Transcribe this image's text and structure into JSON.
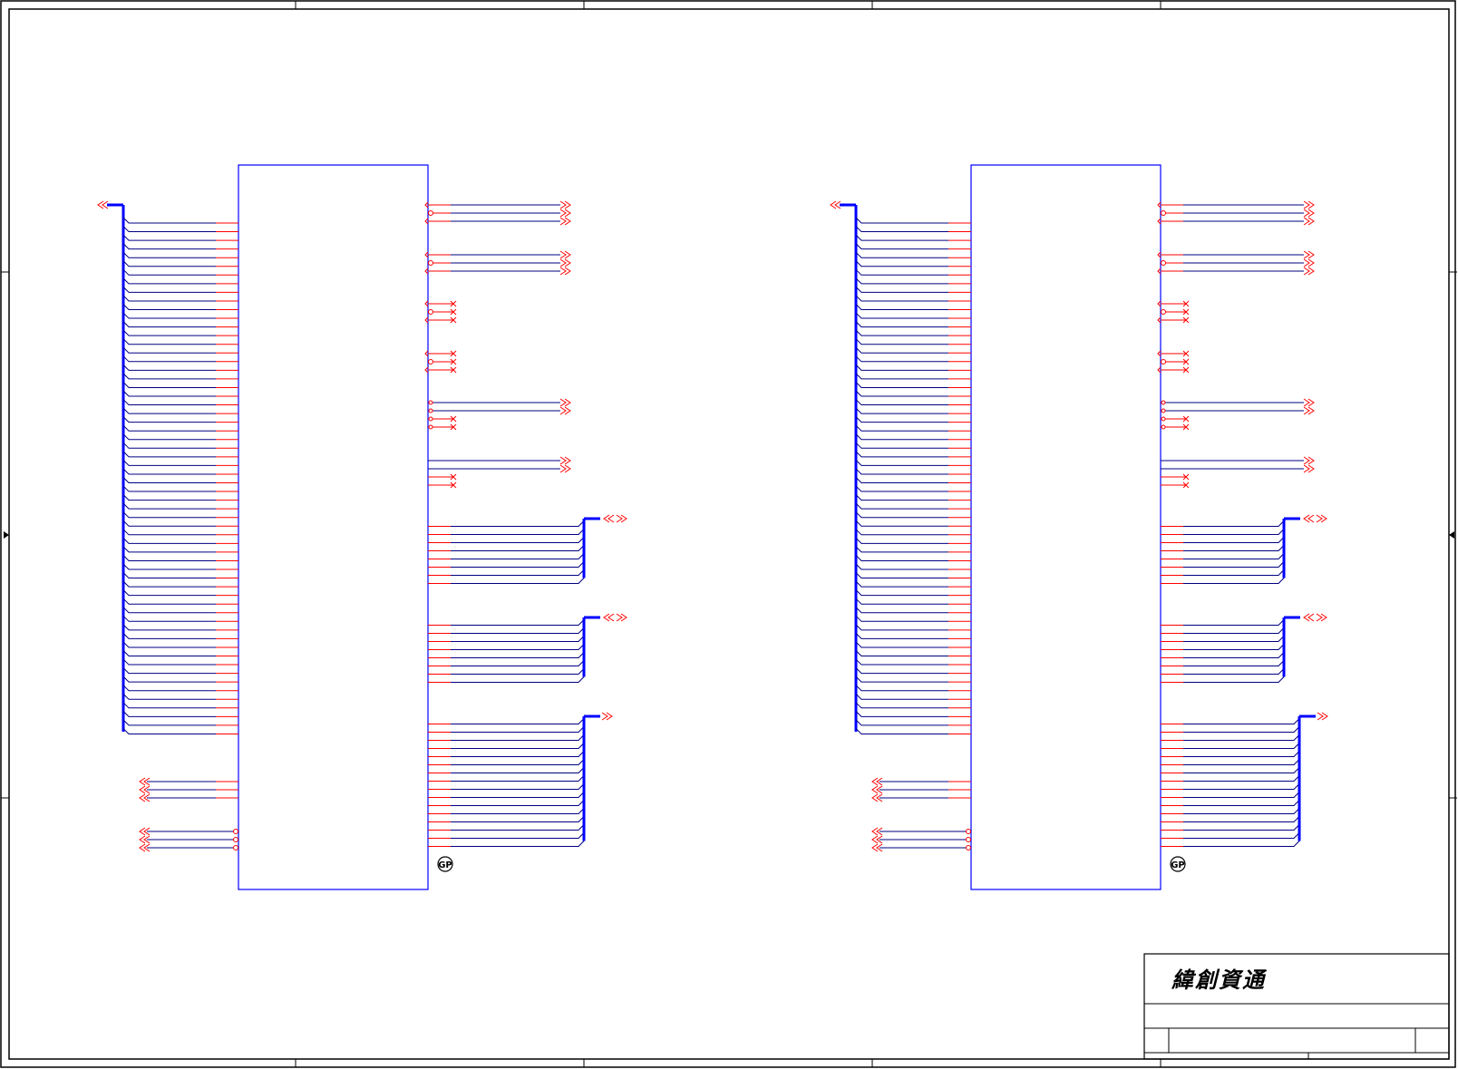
{
  "title_block": {
    "company_name": "緯創資通"
  },
  "symbols": {
    "gp_mark": "GP"
  },
  "colors": {
    "wire": "#ff0000",
    "net": "#000080",
    "bus": "#0000ff",
    "part": "#0000ff",
    "frame": "#000000"
  }
}
